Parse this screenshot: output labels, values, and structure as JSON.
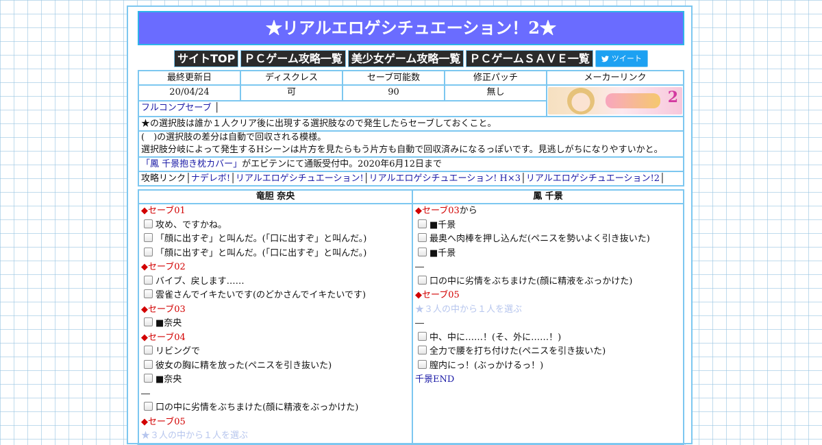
{
  "title": "★リアルエロゲシチュエーション！2★",
  "nav": [
    "サイトTOP",
    "ＰＣゲーム攻略一覧",
    "美少女ゲーム攻略一覧",
    "ＰＣゲームＳＡＶＥ一覧"
  ],
  "tweet_label": "ツイート",
  "info": {
    "headers": [
      "最終更新日",
      "ディスクレス",
      "セーブ可能数",
      "修正パッチ",
      "メーカーリンク"
    ],
    "values": [
      "20/04/24",
      "可",
      "90",
      "無し"
    ],
    "banner_number": "2"
  },
  "fullcomp": "フルコンプセーブ",
  "note1": "★の選択肢は誰か１人クリア後に出現する選択肢なので発生したらセーブしておくこと。",
  "note2a": "(　)の選択肢の差分は自動で回収される模様。",
  "note2b": "選択肢分岐によって発生するHシーンは片方を見たらもう片方も自動で回収済みになるっぽいです。見逃しがちになりやすいかと。",
  "promo_link": "「鳳 千景抱き枕カバー」",
  "promo_text": "がエビテンにて通販受付中。2020年6月12日まで",
  "links_label": "攻略リンク",
  "links": [
    "ナデレボ!",
    "リアルエロゲシチュエーション!",
    "リアルエロゲシチュエーション! H×3",
    "リアルエロゲシチュエーション!2"
  ],
  "left": {
    "header": "竜胆 奈央",
    "items": [
      {
        "t": "save",
        "v": "セーブ01"
      },
      {
        "t": "cb",
        "v": "攻め、ですかね。"
      },
      {
        "t": "cb",
        "v": "「顔に出すぞ」と叫んだ。(「口に出すぞ」と叫んだ。)"
      },
      {
        "t": "cb",
        "v": "「顔に出すぞ」と叫んだ。(「口に出すぞ」と叫んだ。)"
      },
      {
        "t": "save",
        "v": "セーブ02"
      },
      {
        "t": "cb",
        "v": "バイブ、戻します……"
      },
      {
        "t": "cb",
        "v": "雲雀さんでイキたいです(のどかさんでイキたいです)"
      },
      {
        "t": "save",
        "v": "セーブ03"
      },
      {
        "t": "cb",
        "v": "■奈央"
      },
      {
        "t": "save",
        "v": "セーブ04"
      },
      {
        "t": "cb",
        "v": "リビングで"
      },
      {
        "t": "cb",
        "v": "彼女の胸に精を放った(ペニスを引き抜いた)"
      },
      {
        "t": "cb",
        "v": "■奈央"
      },
      {
        "t": "dash",
        "v": "―"
      },
      {
        "t": "cb",
        "v": "口の中に劣情をぶちまけた(顔に精液をぶっかけた)"
      },
      {
        "t": "save",
        "v": "セーブ05"
      },
      {
        "t": "faint",
        "v": "★３人の中から１人を選ぶ"
      }
    ]
  },
  "right": {
    "header": "鳳 千景",
    "items": [
      {
        "t": "save",
        "v": "セーブ03",
        "suffix": "から"
      },
      {
        "t": "cb",
        "v": "■千景"
      },
      {
        "t": "cb",
        "v": "最奥へ肉棒を押し込んだ(ペニスを勢いよく引き抜いた)"
      },
      {
        "t": "cb",
        "v": "■千景"
      },
      {
        "t": "dash",
        "v": "―"
      },
      {
        "t": "cb",
        "v": "口の中に劣情をぶちまけた(顔に精液をぶっかけた)"
      },
      {
        "t": "save",
        "v": "セーブ05"
      },
      {
        "t": "faint",
        "v": "★３人の中から１人を選ぶ"
      },
      {
        "t": "dash",
        "v": "―"
      },
      {
        "t": "cb",
        "v": "中、中に……！(そ、外に……！)"
      },
      {
        "t": "cb",
        "v": "全力で腰を打ち付けた(ペニスを引き抜いた)"
      },
      {
        "t": "cb",
        "v": "膣内にっ！(ぶっかけるっ！)"
      },
      {
        "t": "end",
        "v": "千景END"
      }
    ]
  },
  "colors": {
    "title_bg": "#6a6cff",
    "border": "#7cc7f0",
    "save_red": "#d20000",
    "link": "#1a1aa6"
  }
}
